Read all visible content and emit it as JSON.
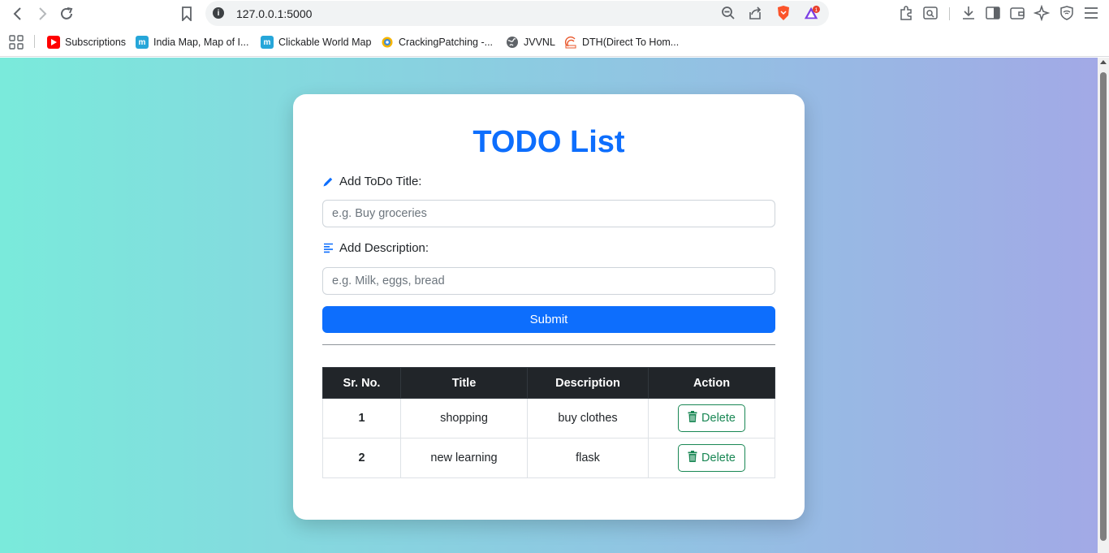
{
  "browser": {
    "url": "127.0.0.1:5000",
    "brave_badge_count": "1",
    "bookmarks": [
      {
        "label": "Subscriptions",
        "icon": "youtube-icon"
      },
      {
        "label": "India Map, Map of I...",
        "icon": "m-site-icon"
      },
      {
        "label": "Clickable World Map",
        "icon": "m-site-icon"
      },
      {
        "label": "CrackingPatching -...",
        "icon": "crackingpatching-icon"
      },
      {
        "label": "JVVNL",
        "icon": "globe-icon"
      },
      {
        "label": "DTH(Direct To Hom...",
        "icon": "dth-icon"
      }
    ]
  },
  "page": {
    "title": "TODO List",
    "form": {
      "title_label": "Add ToDo Title:",
      "title_placeholder": "e.g. Buy groceries",
      "desc_label": "Add Description:",
      "desc_placeholder": "e.g. Milk, eggs, bread",
      "submit_label": "Submit"
    },
    "table": {
      "headers": [
        "Sr. No.",
        "Title",
        "Description",
        "Action"
      ],
      "rows": [
        {
          "sr": "1",
          "title": "shopping",
          "description": "buy clothes",
          "action": "Delete"
        },
        {
          "sr": "2",
          "title": "new learning",
          "description": "flask",
          "action": "Delete"
        }
      ]
    }
  },
  "colors": {
    "accent": "#0d6efd",
    "delete": "#198754",
    "table_header": "#212529"
  }
}
